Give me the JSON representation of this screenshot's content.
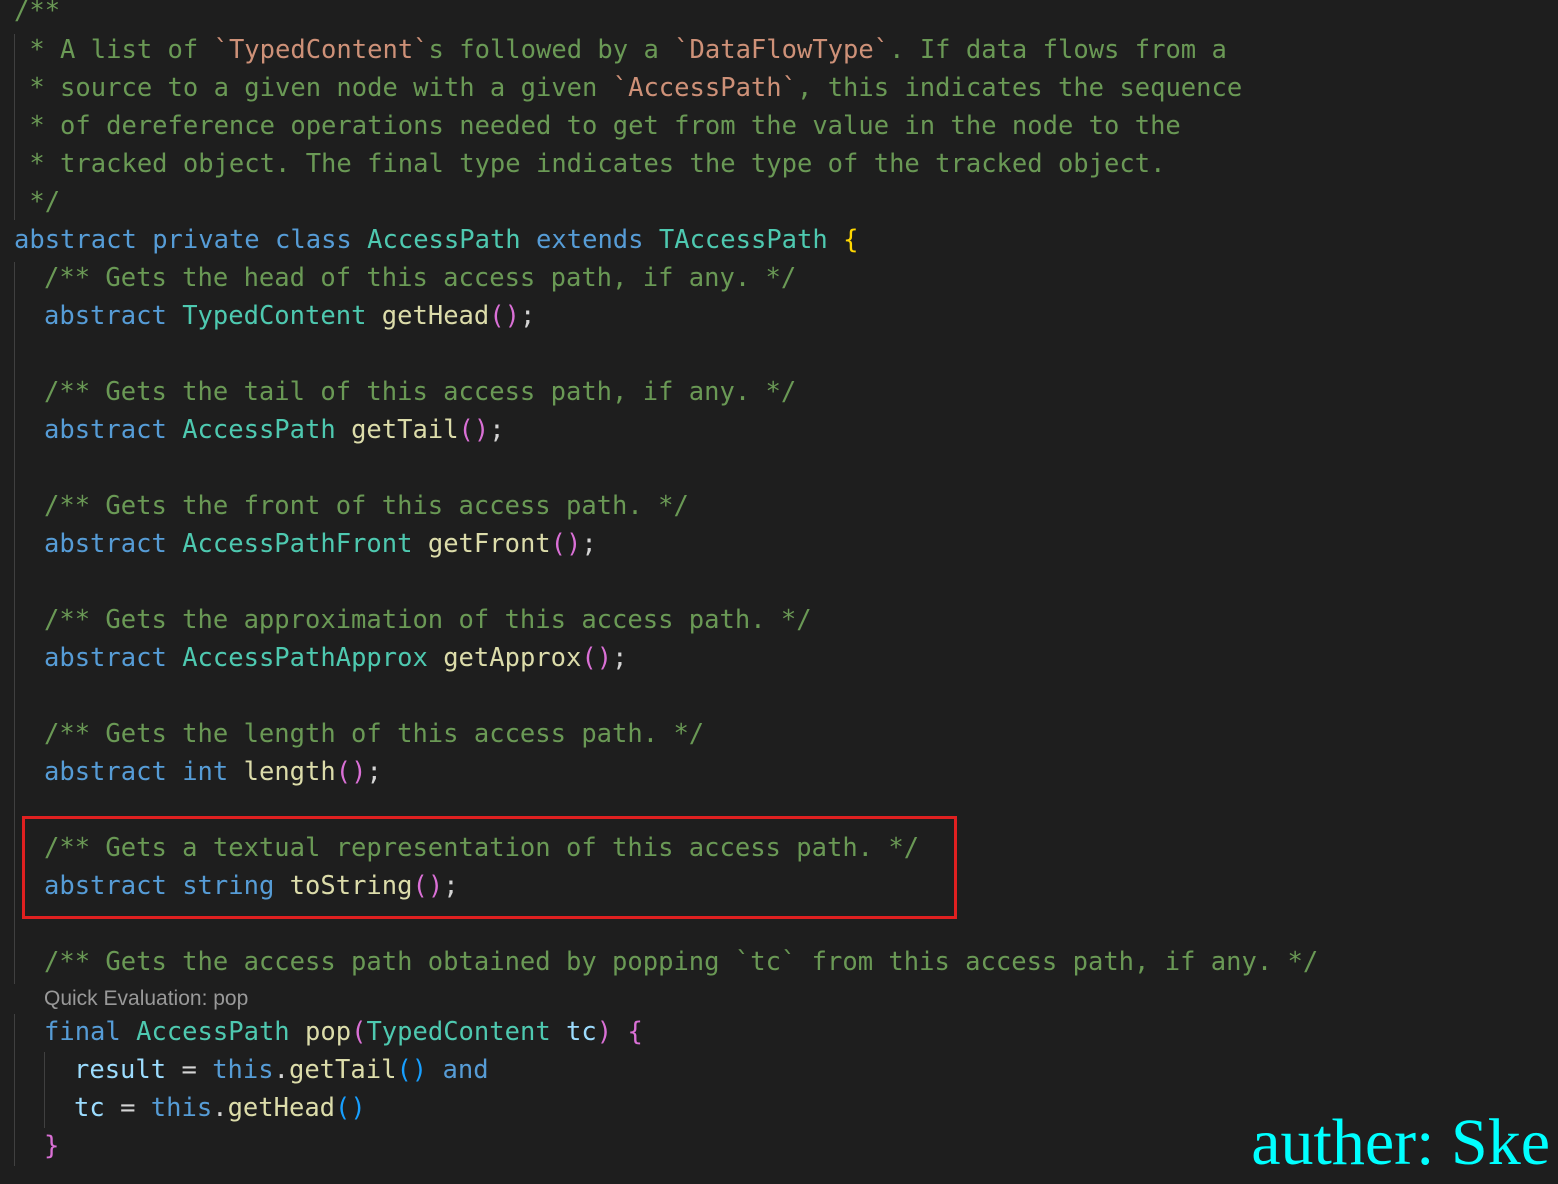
{
  "doc_comment": {
    "l1": "/**",
    "l2a": " * A list of ",
    "l2b": "`TypedContent`",
    "l2c": "s followed by a ",
    "l2d": "`DataFlowType`",
    "l2e": ". If data flows from a",
    "l3a": " * source to a given node with a given ",
    "l3b": "`AccessPath`",
    "l3c": ", this indicates the sequence",
    "l4": " * of dereference operations needed to get from the value in the node to the",
    "l5": " * tracked object. The final type indicates the type of the tracked object.",
    "l6": " */"
  },
  "class_decl": {
    "abstract": "abstract",
    "private": "private",
    "class": "class",
    "name": "AccessPath",
    "extends": "extends",
    "base": "TAccessPath",
    "brace": "{"
  },
  "members": [
    {
      "comment": "/** Gets the head of this access path, if any. */",
      "modifier": "abstract",
      "type": "TypedContent",
      "name": "getHead",
      "parens": "()",
      "semi": ";"
    },
    {
      "comment": "/** Gets the tail of this access path, if any. */",
      "modifier": "abstract",
      "type": "AccessPath",
      "name": "getTail",
      "parens": "()",
      "semi": ";"
    },
    {
      "comment": "/** Gets the front of this access path. */",
      "modifier": "abstract",
      "type": "AccessPathFront",
      "name": "getFront",
      "parens": "()",
      "semi": ";"
    },
    {
      "comment": "/** Gets the approximation of this access path. */",
      "modifier": "abstract",
      "type": "AccessPathApprox",
      "name": "getApprox",
      "parens": "()",
      "semi": ";"
    },
    {
      "comment": "/** Gets the length of this access path. */",
      "modifier": "abstract",
      "type": "int",
      "name": "length",
      "parens": "()",
      "semi": ";"
    },
    {
      "comment": "/** Gets a textual representation of this access path. */",
      "modifier": "abstract",
      "type": "string",
      "name": "toString",
      "parens": "()",
      "semi": ";"
    }
  ],
  "pop_method": {
    "comment_a": "/** Gets the access path obtained by popping ",
    "comment_b": "`tc`",
    "comment_c": " from this access path, if any. */",
    "codelens": "Quick Evaluation: pop",
    "final": "final",
    "type": "AccessPath",
    "name": "pop",
    "open_paren": "(",
    "param_type": "TypedContent",
    "param_name": "tc",
    "close_paren": ")",
    "open_brace": "{",
    "body1_var": "result",
    "body1_eq": " = ",
    "body1_this": "this",
    "body1_dot": ".",
    "body1_call": "getTail",
    "body1_parens": "()",
    "body1_and": "and",
    "body2_var": "tc",
    "body2_eq": " = ",
    "body2_this": "this",
    "body2_dot": ".",
    "body2_call": "getHead",
    "body2_parens": "()",
    "close_brace": "}"
  },
  "watermark": "auther: Ske",
  "colors": {
    "background": "#1e1e1e",
    "comment": "#6a9955",
    "keyword": "#569cd6",
    "type": "#4ec9b0",
    "function": "#dcdcaa",
    "variable": "#9cdcfe",
    "highlight_box": "#e02020",
    "watermark": "#00ffff"
  }
}
